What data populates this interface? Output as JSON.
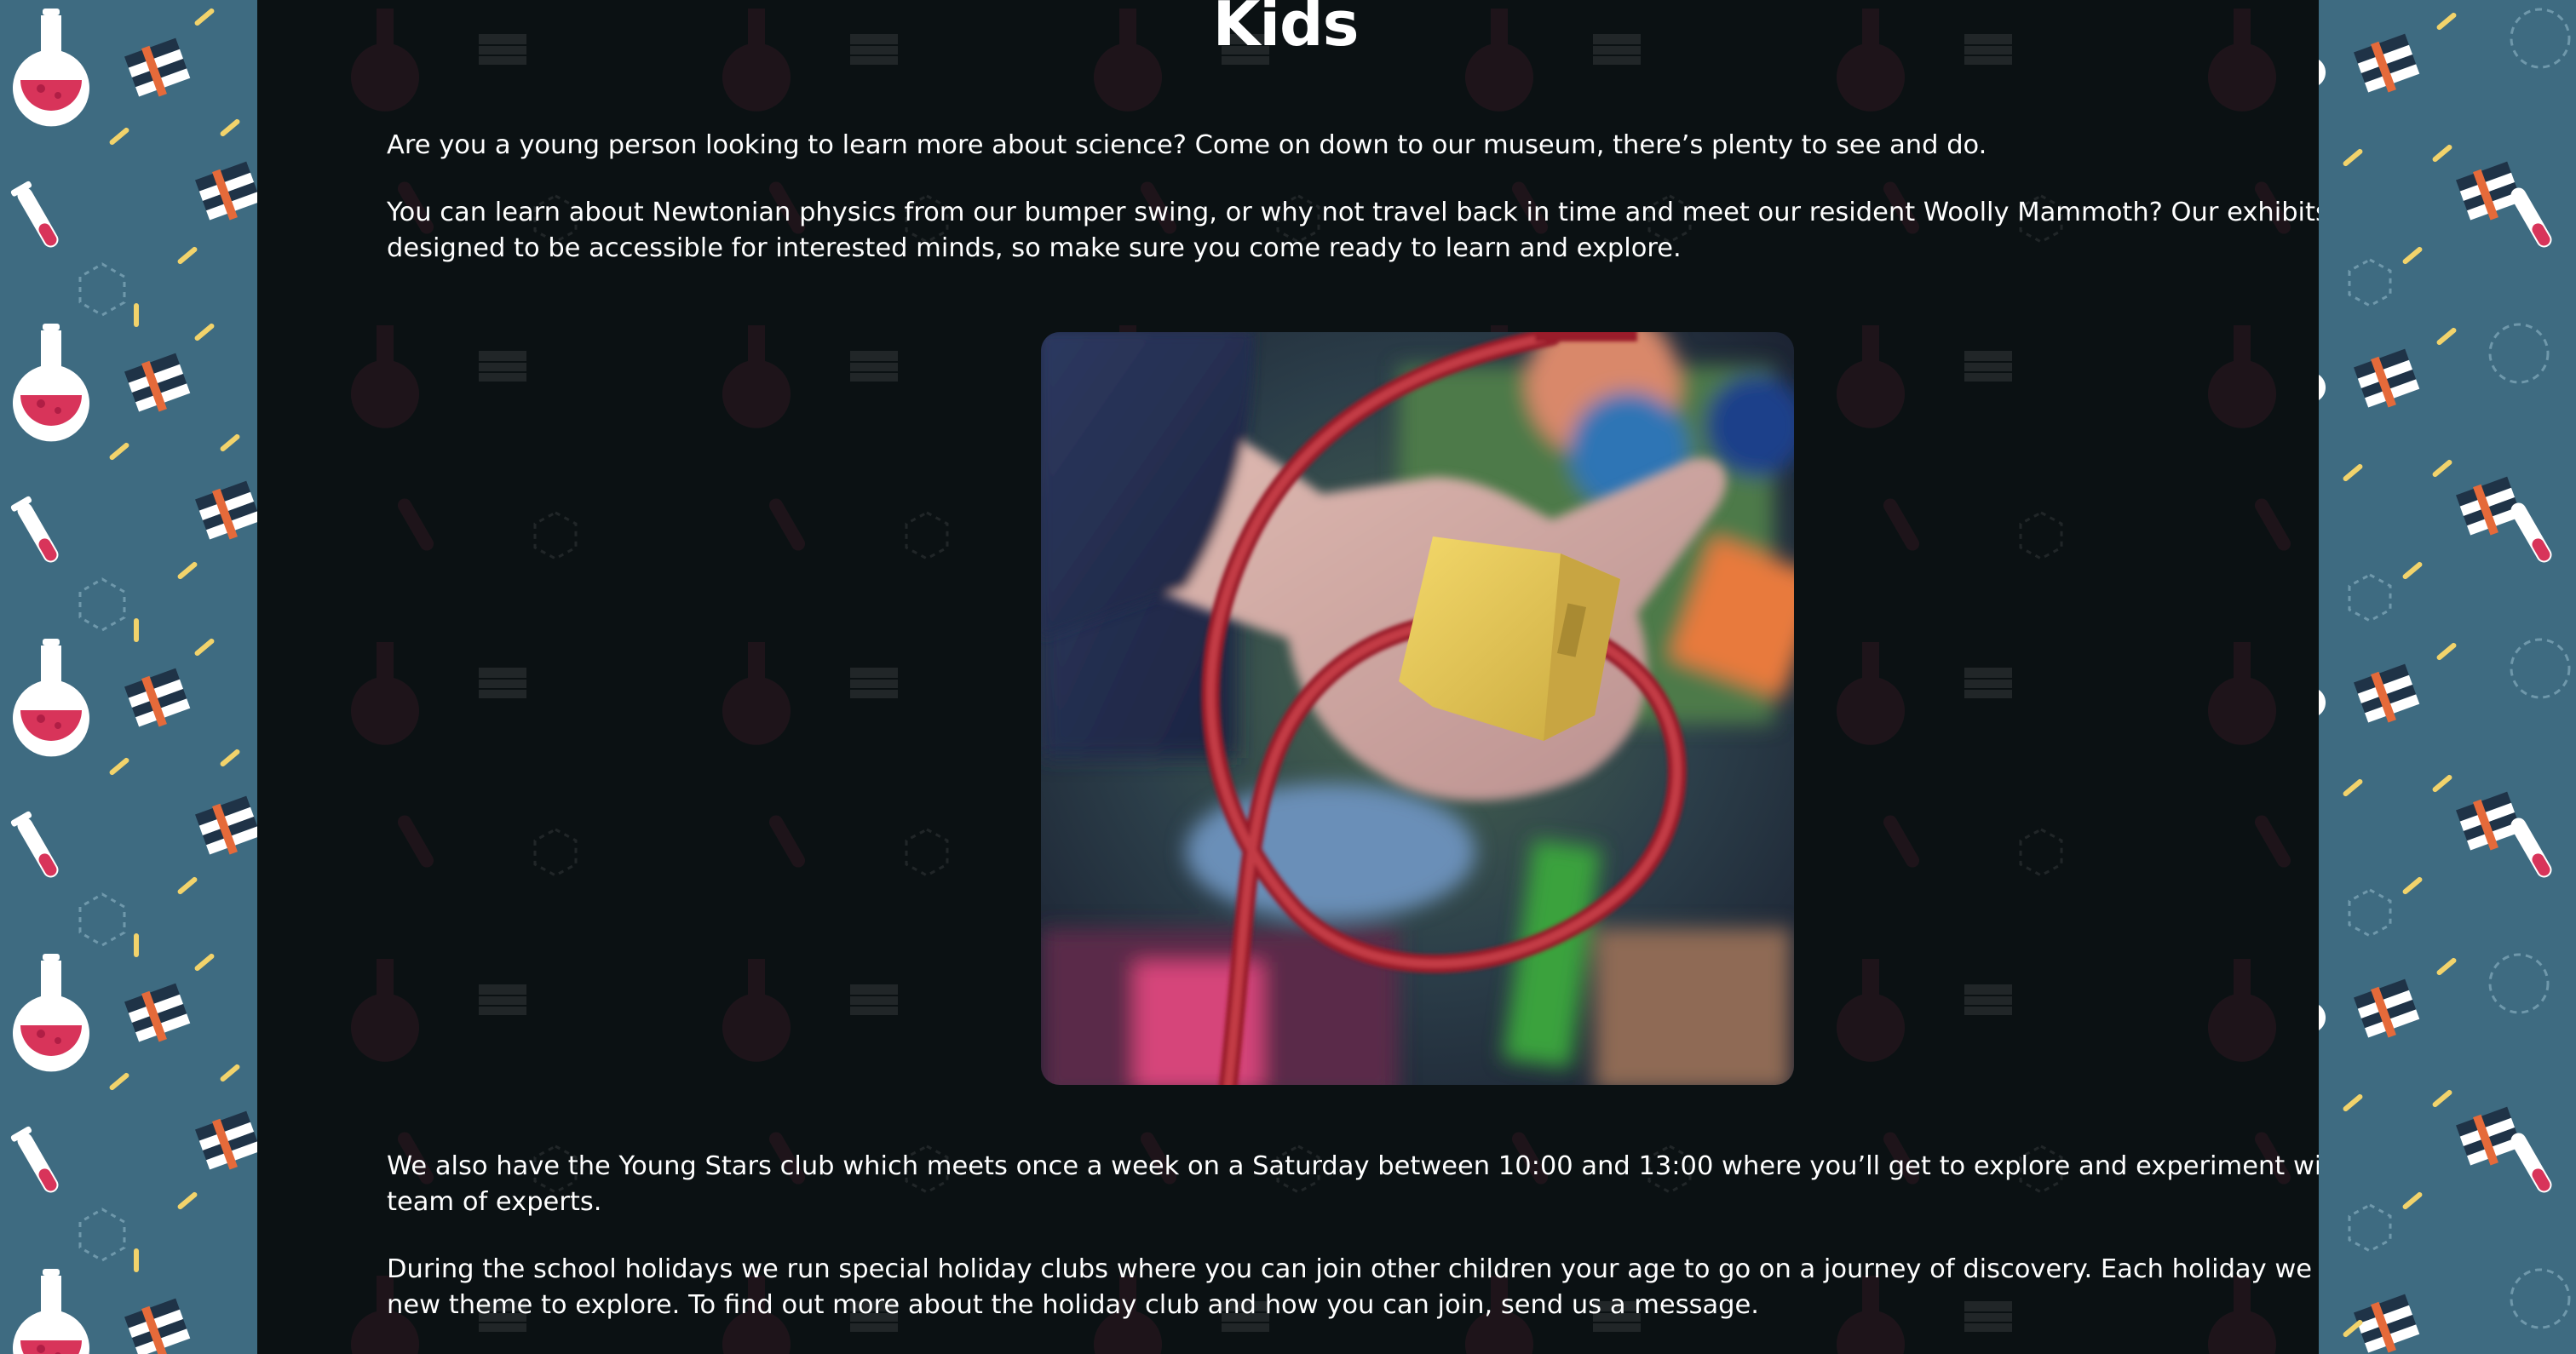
{
  "page": {
    "title": "Kids",
    "paragraphs": [
      "Are you a young person looking to learn more about science? Come on down to our museum, there’s plenty to see and do.",
      "You can learn about Newtonian physics from our bumper swing, or why not travel back in time and meet our resident Woolly Mammoth? Our exhibits are designed to be accessible for interested minds, so make sure you come ready to learn and explore.",
      "We also have the Young Stars club which meets once a week on a Saturday between 10:00 and 13:00 where you’ll get to explore and experiment with our team of experts.",
      "During the school holidays we run special holiday clubs where you can join other children your age to go on a journey of discovery. Each holiday we pick a new theme to explore. To find out more about the holiday club and how you can join, send us a message."
    ]
  },
  "image": {
    "subject": "child's hand moving a yellow wooden bead along a red wire bead maze toy"
  },
  "decor": {
    "side_pattern_icons": [
      "flask-icon",
      "test-tube-icon",
      "books-icon",
      "hexagon-icon",
      "dashed-circle-icon"
    ],
    "colors": {
      "side_background": "#3e6b81",
      "main_background": "#0b1113",
      "flask_red": "#d8345a",
      "confetti_yellow": "#f2d36b",
      "book_navy": "#1f3347",
      "text": "#ffffff"
    }
  }
}
